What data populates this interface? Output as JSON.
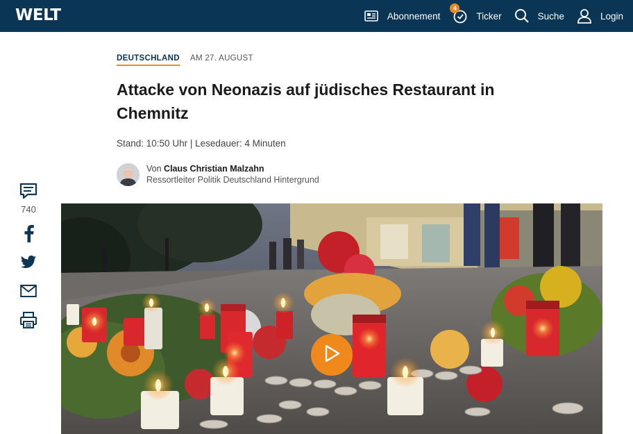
{
  "header": {
    "logo": "WELT",
    "nav": [
      {
        "label": "Abonnement",
        "icon": "newspaper-icon"
      },
      {
        "label": "Ticker",
        "icon": "clock-icon",
        "badge": "4"
      },
      {
        "label": "Suche",
        "icon": "search-icon"
      },
      {
        "label": "Login",
        "icon": "user-icon"
      }
    ]
  },
  "article": {
    "category": "DEUTSCHLAND",
    "date": "AM 27. AUGUST",
    "title": "Attacke von Neonazis auf jüdisches Restaurant in Chemnitz",
    "meta": "Stand: 10:50 Uhr | Lesedauer: 4 Minuten",
    "author_prefix": "Von",
    "author_name": "Claus Christian Malzahn",
    "author_role": "Ressortleiter Politik Deutschland Hintergrund"
  },
  "social": {
    "comment_count": "740",
    "items": [
      "comment-icon",
      "facebook-icon",
      "twitter-icon",
      "mail-icon",
      "print-icon"
    ]
  },
  "colors": {
    "header_bg": "#0a3555",
    "accent": "#f0891b"
  }
}
